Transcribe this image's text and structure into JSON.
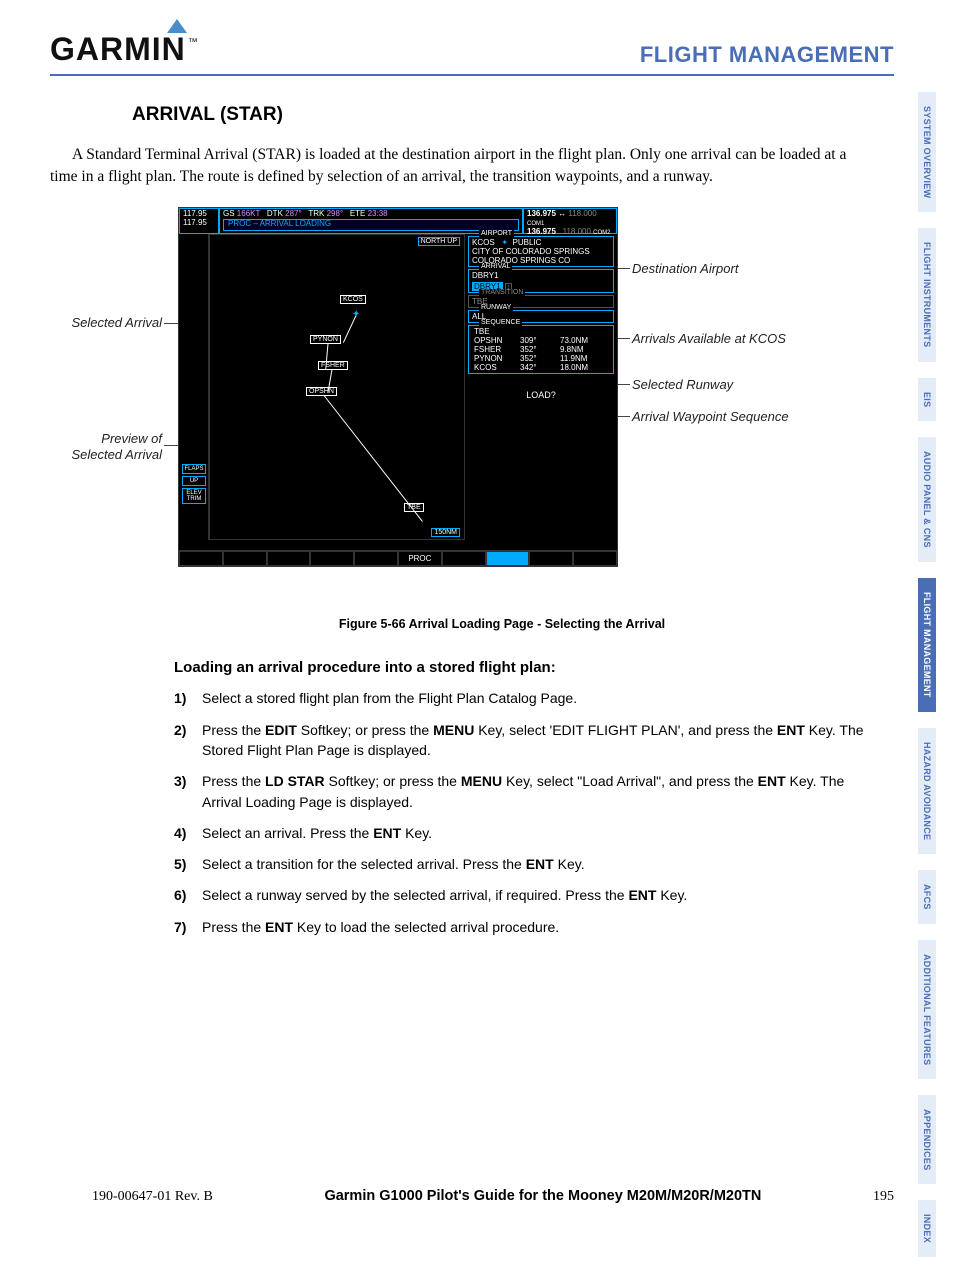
{
  "header": {
    "logo": "GARMIN",
    "section": "FLIGHT MANAGEMENT"
  },
  "tabs": [
    {
      "label": "SYSTEM OVERVIEW"
    },
    {
      "label": "FLIGHT INSTRUMENTS"
    },
    {
      "label": "EIS"
    },
    {
      "label": "AUDIO PANEL & CNS"
    },
    {
      "label": "FLIGHT MANAGEMENT",
      "active": true
    },
    {
      "label": "HAZARD AVOIDANCE"
    },
    {
      "label": "AFCS"
    },
    {
      "label": "ADDITIONAL FEATURES"
    },
    {
      "label": "APPENDICES"
    },
    {
      "label": "INDEX"
    }
  ],
  "title": "ARRIVAL (STAR)",
  "intro": "A Standard Terminal Arrival (STAR) is loaded at the destination airport in the flight plan. Only one arrival can be loaded at a time in a flight plan. The route is defined by selection of an arrival, the transition waypoints, and a runway.",
  "callouts": {
    "left1": "Selected Arrival",
    "left2a": "Preview of",
    "left2b": "Selected Arrival",
    "right1": "Destination Airport",
    "right2": "Arrivals Available at KCOS",
    "right3": "Selected Runway",
    "right4": "Arrival Waypoint Sequence"
  },
  "mfd": {
    "nav1": "117.95",
    "nav2": "117.95",
    "gs_lbl": "GS",
    "gs": "166KT",
    "dtk_lbl": "DTK",
    "dtk": "287°",
    "trk_lbl": "TRK",
    "trk": "298°",
    "ete_lbl": "ETE",
    "ete": "23:38",
    "com1a": "136.975",
    "com1b": "118.000",
    "com1t": "COM1",
    "com2a": "136.975",
    "com2b": "118.000",
    "com2t": "COM2",
    "proc": "PROC – ARRIVAL LOADING",
    "northup": "NORTH UP",
    "scale": "150NM",
    "flaps": "FLAPS",
    "flaps_v": "UP",
    "elev": "ELEV TRIM",
    "airport_lbl": "AIRPORT",
    "airport_id": "KCOS",
    "airport_type": "PUBLIC",
    "airport_name": "CITY OF COLORADO SPRINGS",
    "airport_loc": "COLORADO SPRINGS CO",
    "arrival_lbl": "ARRIVAL",
    "arrival": "DBRY1",
    "arrival_sel": "DBRY1",
    "trans_lbl": "TRANSITION",
    "trans": "TBE",
    "runway_lbl": "RUNWAY",
    "runway": "ALL",
    "sequence_lbl": "SEQUENCE",
    "seq": [
      {
        "w": "TBE",
        "b": "",
        "d": ""
      },
      {
        "w": "OPSHN",
        "b": "309°",
        "d": "73.0NM"
      },
      {
        "w": "FSHER",
        "b": "352°",
        "d": "9.8NM"
      },
      {
        "w": "PYNON",
        "b": "352°",
        "d": "11.9NM"
      },
      {
        "w": "KCOS",
        "b": "342°",
        "d": "18.0NM"
      }
    ],
    "load": "LOAD?",
    "wpts": {
      "kcos": "KCOS",
      "pynon": "PYNON",
      "fsher": "FSHER",
      "opshn": "OPSHN",
      "tbe": "TBE"
    },
    "btm_proc": "PROC"
  },
  "figcap": "Figure 5-66  Arrival Loading Page - Selecting the Arrival",
  "subheading": "Loading an arrival procedure into a stored flight plan:",
  "steps": [
    {
      "n": "1)",
      "pre": "Select a stored flight plan from the Flight Plan Catalog Page."
    },
    {
      "n": "2)",
      "pre": "Press the ",
      "b1": "EDIT",
      "m1": " Softkey; or press the ",
      "b2": "MENU",
      "m2": " Key, select 'EDIT FLIGHT PLAN', and press the ",
      "b3": "ENT",
      "post": " Key.  The Stored Flight Plan Page is displayed."
    },
    {
      "n": "3)",
      "pre": "Press the ",
      "b1": "LD STAR",
      "m1": " Softkey; or press the ",
      "b2": "MENU",
      "m2": " Key, select \"Load Arrival\", and press the ",
      "b3": "ENT",
      "post": " Key.  The Arrival Loading Page is displayed."
    },
    {
      "n": "4)",
      "pre": "Select an arrival.  Press the ",
      "b1": "ENT",
      "post": " Key."
    },
    {
      "n": "5)",
      "pre": "Select a transition for the selected arrival.  Press the ",
      "b1": "ENT",
      "post": " Key."
    },
    {
      "n": "6)",
      "pre": "Select a runway served by the selected arrival, if required.  Press the ",
      "b1": "ENT",
      "post": " Key."
    },
    {
      "n": "7)",
      "pre": "Press the ",
      "b1": "ENT",
      "post": " Key to load the selected arrival procedure."
    }
  ],
  "footer": {
    "rev": "190-00647-01  Rev. B",
    "mid": "Garmin G1000 Pilot's Guide for the Mooney M20M/M20R/M20TN",
    "page": "195"
  }
}
